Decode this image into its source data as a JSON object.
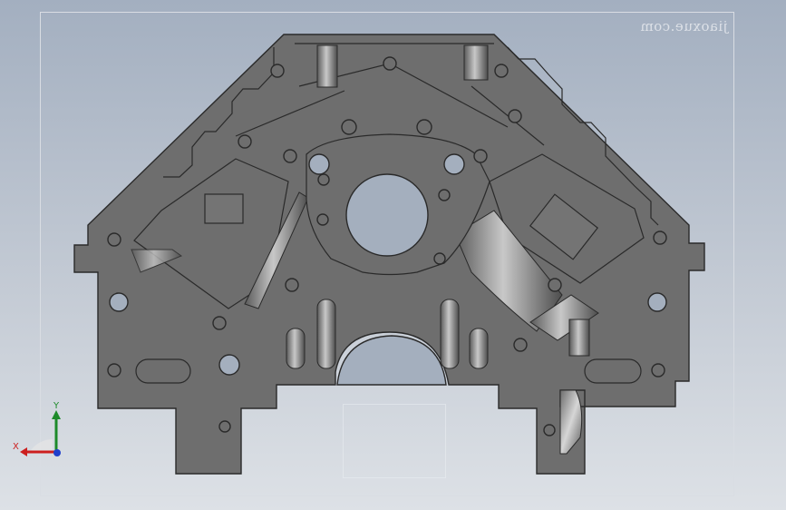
{
  "watermark": {
    "text": "jiaoxue.com"
  },
  "triad": {
    "x_label": "X",
    "y_label": "Y",
    "x_color": "#cc1f1f",
    "y_color": "#1d8a2a",
    "z_color": "#1f3fcc"
  },
  "model": {
    "body_color": "#6e6e6e",
    "edge_color": "#2a2a2a",
    "bore_color": "#a4afbe",
    "cylinder_highlight": "#c7c7c7"
  }
}
